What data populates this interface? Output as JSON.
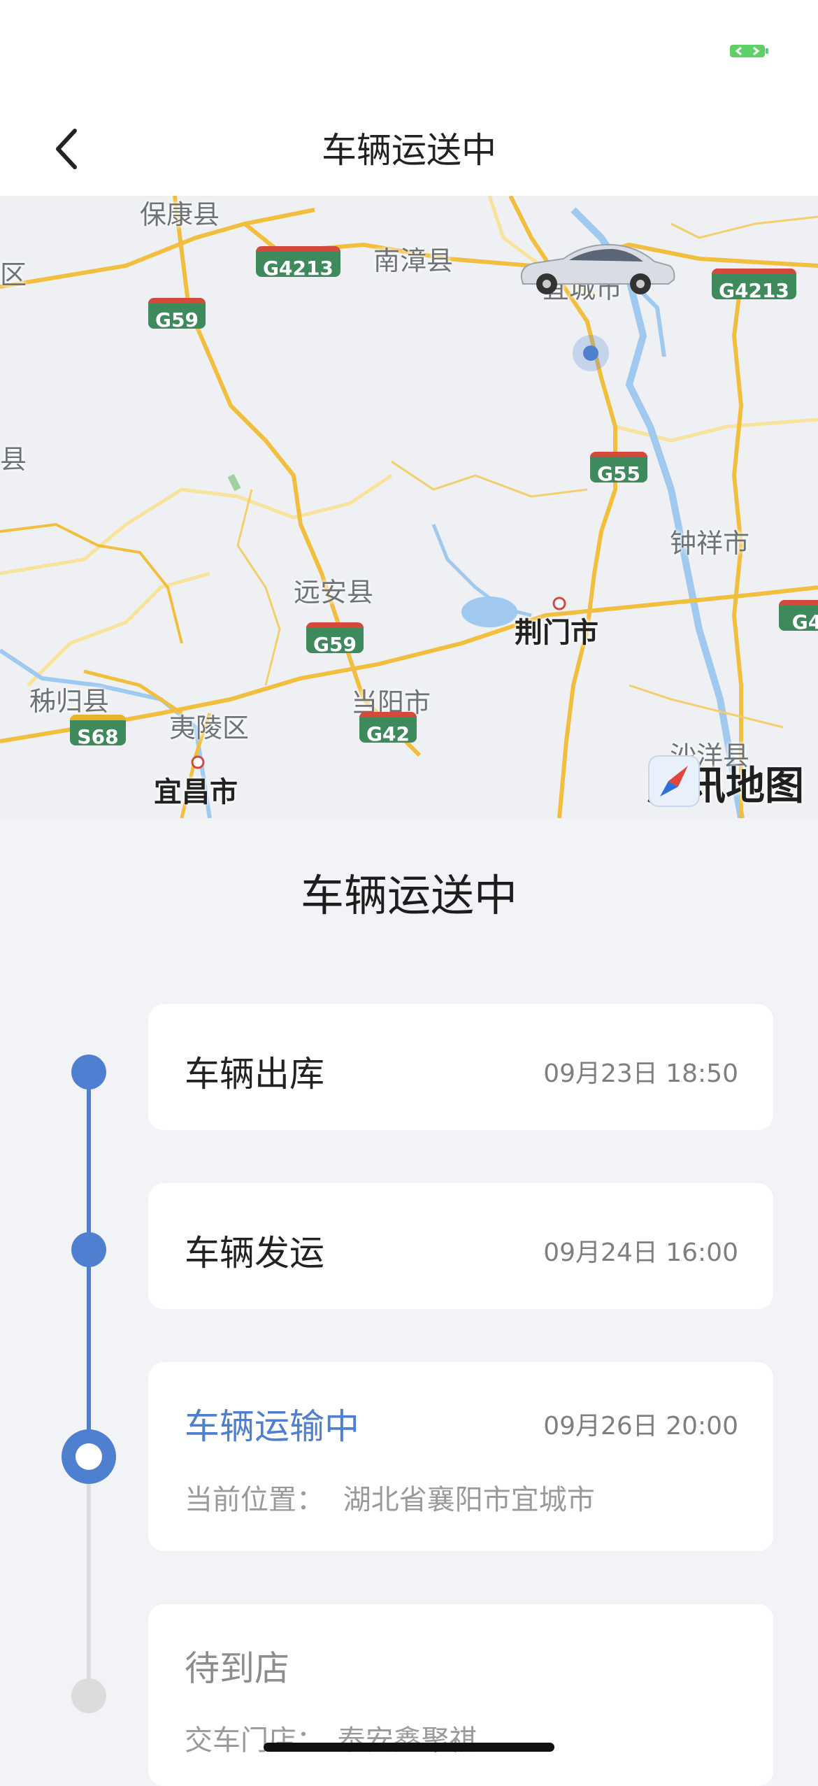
{
  "nav": {
    "title": "车辆运送中"
  },
  "map": {
    "labels": {
      "baokang": "保康县",
      "nanzhang": "南漳县",
      "yicheng": "宜城市",
      "zhongxiang": "钟祥市",
      "yuanan": "远安县",
      "jingmen": "荆门市",
      "zigui": "秭归县",
      "yiling": "夷陵区",
      "dangyang": "当阳市",
      "shayang": "沙洋县",
      "yichang": "宜昌市",
      "edge_qu": "区",
      "edge_xian": "县"
    },
    "shields": {
      "g4213_left": "G4213",
      "g4213_right": "G4213",
      "g59_top": "G59",
      "g55": "G55",
      "g59_mid": "G59",
      "s68": "S68",
      "g42": "G42",
      "g4_edge": "G4"
    },
    "logo_text": "腾讯地图",
    "route_color": "#f1bf3d",
    "water_color": "#9fc9ee"
  },
  "section_title": "车辆运送中",
  "timeline": {
    "steps": [
      {
        "title": "车辆出库",
        "time": "09月23日 18:50"
      },
      {
        "title": "车辆发运",
        "time": "09月24日 16:00"
      },
      {
        "title": "车辆运输中",
        "time": "09月26日 20:00",
        "sub_label": "当前位置：",
        "sub_value": "湖北省襄阳市宜城市"
      },
      {
        "title": "待到店",
        "sub_label": "交车门店：",
        "sub_value": "泰安鑫聚祺"
      }
    ],
    "colors": {
      "active": "#4f7fcf",
      "pending": "#dcdcdc",
      "current_text": "#4f7fcf"
    }
  }
}
